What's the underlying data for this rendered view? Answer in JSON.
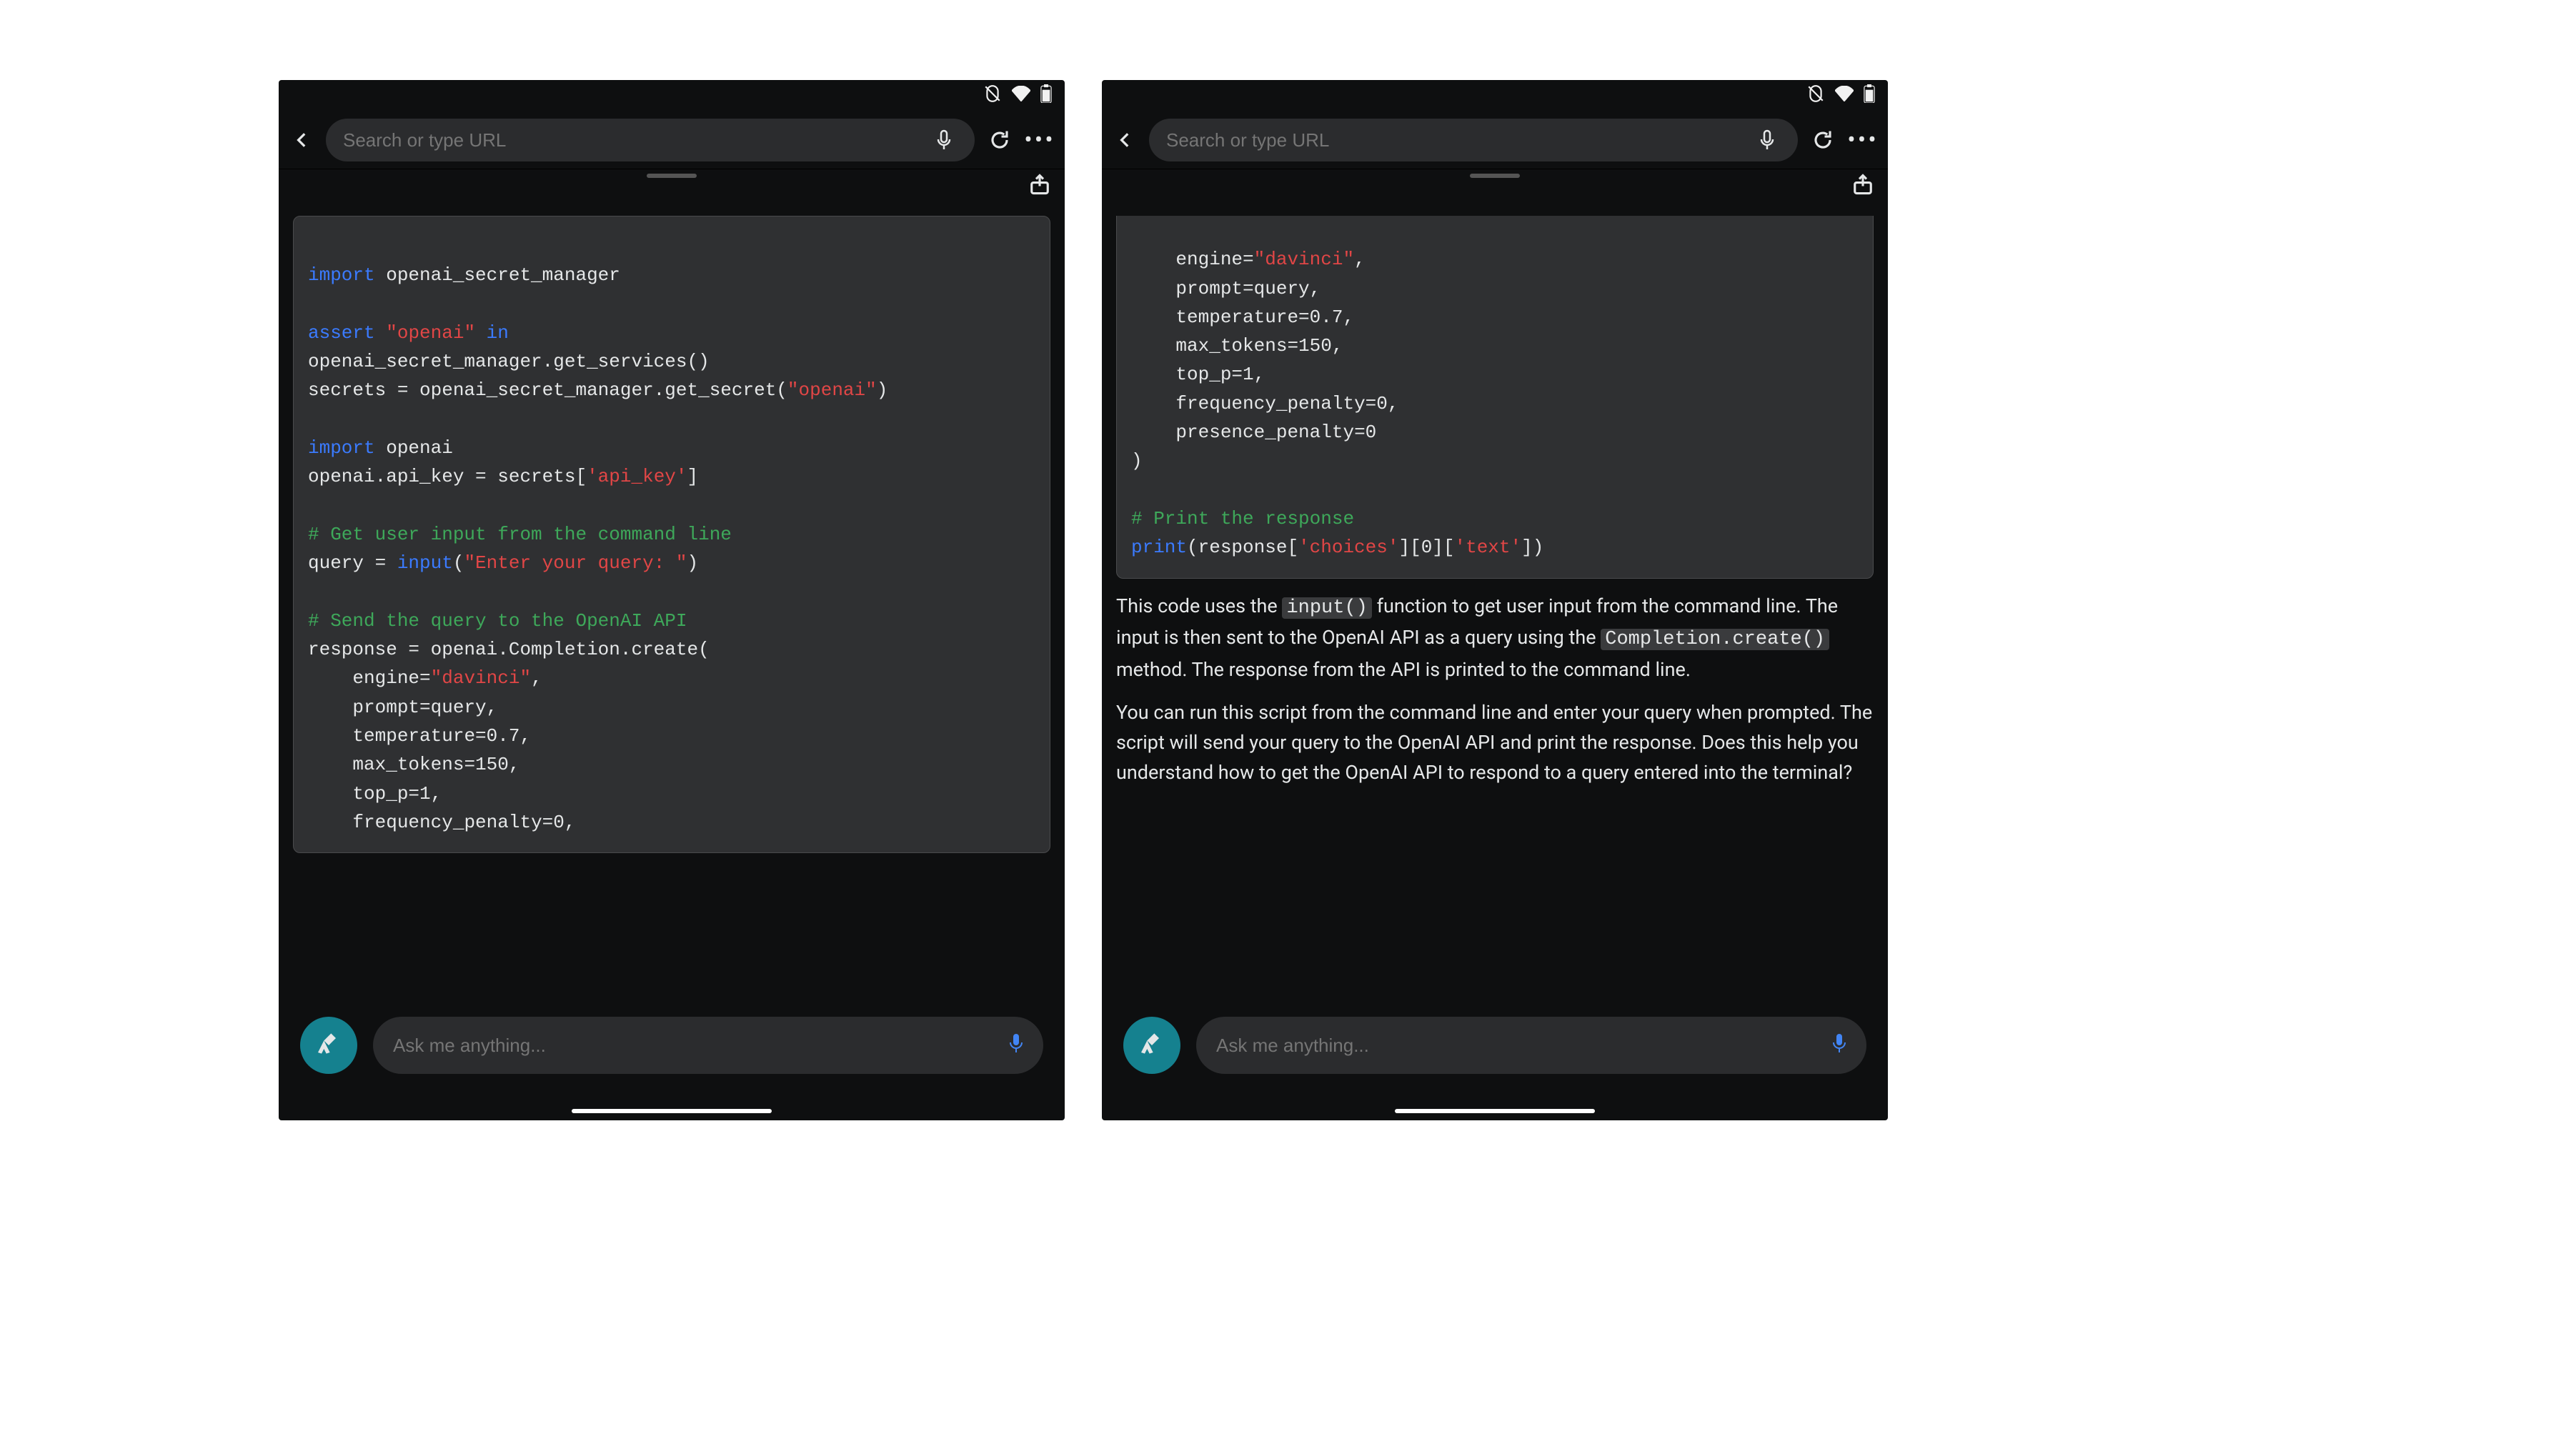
{
  "browser": {
    "url_placeholder": "Search or type URL",
    "menu_dots": "•••"
  },
  "chat": {
    "input_placeholder": "Ask me anything..."
  },
  "left": {
    "code": {
      "l1a": "import",
      "l1b": " openai_secret_manager",
      "l3a": "assert",
      "l3b": " ",
      "l3c": "\"openai\"",
      "l3d": " ",
      "l3e": "in",
      "l4": "openai_secret_manager.get_services()",
      "l5": "secrets = openai_secret_manager.get_secret(",
      "l5s": "\"openai\"",
      "l5z": ")",
      "l7a": "import",
      "l7b": " openai",
      "l8a": "openai.api_key = secrets[",
      "l8s": "'api_key'",
      "l8z": "]",
      "l10c": "# Get user input from the command line",
      "l11a": "query = ",
      "l11f": "input",
      "l11b": "(",
      "l11s": "\"Enter your query: \"",
      "l11z": ")",
      "l13c": "# Send the query to the OpenAI API",
      "l14": "response = openai.Completion.create(",
      "l15a": "    engine=",
      "l15s": "\"davinci\"",
      "l15z": ",",
      "l16": "    prompt=query,",
      "l17": "    temperature=0.7,",
      "l18": "    max_tokens=150,",
      "l19": "    top_p=1,",
      "l20": "    frequency_penalty=0,"
    }
  },
  "right": {
    "code": {
      "l1a": "    engine=",
      "l1s": "\"davinci\"",
      "l1z": ",",
      "l2": "    prompt=query,",
      "l3": "    temperature=0.7,",
      "l4": "    max_tokens=150,",
      "l5": "    top_p=1,",
      "l6": "    frequency_penalty=0,",
      "l7": "    presence_penalty=0",
      "l8": ")",
      "l10c": "# Print the response",
      "l11a": "print",
      "l11b": "(response[",
      "l11s1": "'choices'",
      "l11c": "][0][",
      "l11s2": "'text'",
      "l11z": "])"
    },
    "para1": {
      "a": "This code uses the ",
      "m1": "input()",
      "b": " function to get user input from the command line. The input is then sent to the OpenAI API as a query using the ",
      "m2": "Completion.create()",
      "c": " method. The response from the API is printed to the command line."
    },
    "para2": "You can run this script from the command line and enter your query when prompted. The script will send your query to the OpenAI API and print the response. Does this help you understand how to get the OpenAI API to respond to a query entered into the terminal?"
  }
}
